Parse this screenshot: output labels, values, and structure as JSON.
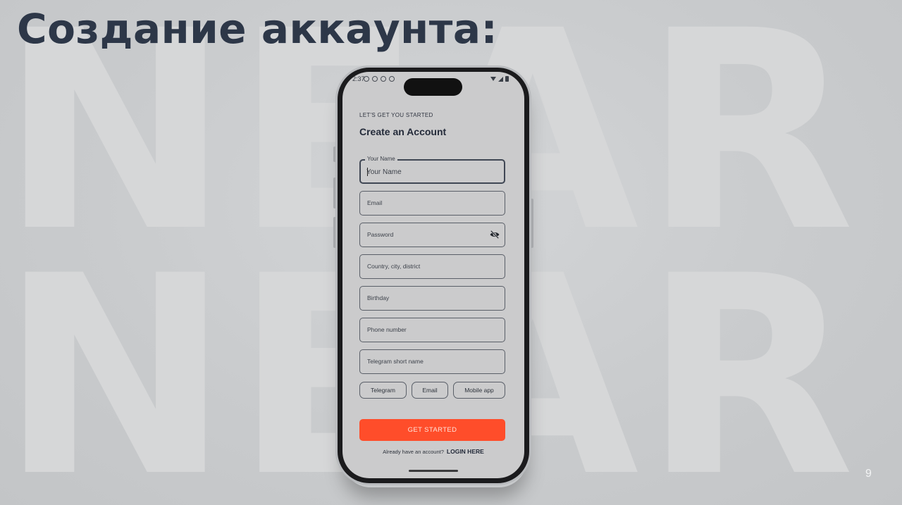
{
  "slide": {
    "title": "Создание аккаунта:",
    "watermark_word": "NEAR",
    "page_number": "9"
  },
  "phone": {
    "status_bar": {
      "time": "2:37"
    },
    "eyebrow": "LET'S GET YOU STARTED",
    "title": "Create an Account",
    "fields": {
      "name": {
        "label": "Your Name",
        "placeholder": "Your Name"
      },
      "email": {
        "label": "Email"
      },
      "password": {
        "label": "Password"
      },
      "location": {
        "label": "Country, city, district"
      },
      "birthday": {
        "label": "Birthday"
      },
      "phone": {
        "label": "Phone number"
      },
      "telegram": {
        "label": "Telegram short name"
      }
    },
    "contact_options": [
      "Telegram",
      "Email",
      "Mobile app"
    ],
    "cta_label": "GET STARTED",
    "login_prompt": "Already have an account?",
    "login_link": "LOGIN HERE"
  },
  "colors": {
    "background": "#c9cbcd",
    "title": "#2d3748",
    "cta": "#ff4d2a"
  },
  "icons": [
    "eye-off-icon"
  ]
}
